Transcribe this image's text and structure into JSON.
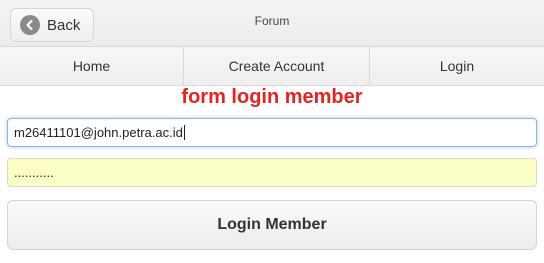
{
  "header": {
    "back_label": "Back",
    "title": "Forum"
  },
  "navbar": {
    "items": [
      {
        "label": "Home"
      },
      {
        "label": "Create Account"
      },
      {
        "label": "Login"
      }
    ]
  },
  "form": {
    "title": "form login member",
    "email_value": "m26411101@john.petra.ac.id",
    "password_masked": "...........",
    "submit_label": "Login Member"
  },
  "colors": {
    "title_red": "#e8231f",
    "password_bg": "#fbfdc7",
    "focus_border": "#8fb6e0"
  },
  "icons": {
    "back": "chevron-left-icon"
  }
}
